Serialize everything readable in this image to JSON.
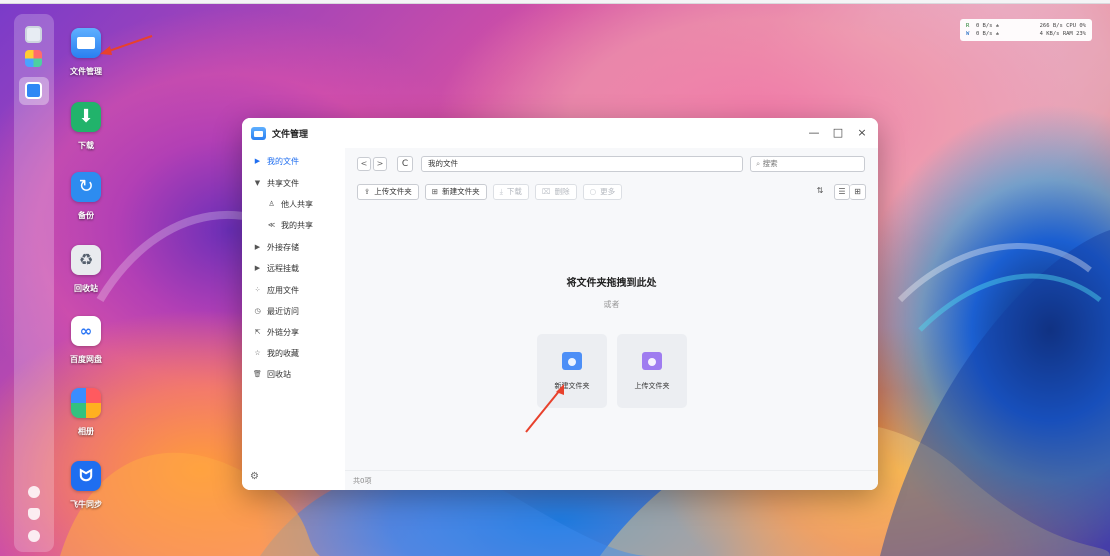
{
  "desktop": {
    "icons": [
      {
        "label": "文件管理"
      },
      {
        "label": "下载"
      },
      {
        "label": "备份"
      },
      {
        "label": "回收站"
      },
      {
        "label": "百度网盘"
      },
      {
        "label": "相册"
      },
      {
        "label": "飞牛同步"
      }
    ],
    "baidu_glyph": "∞",
    "sync_glyph": "ᗢ"
  },
  "system_monitor": {
    "rx_label": "R",
    "tx_label": "W",
    "rx_rate": "0 B/s",
    "tx_rate": "0 B/s",
    "rx_up": "266 B/s",
    "tx_up": "4 KB/s",
    "cpu_label": "CPU",
    "cpu_value": "0%",
    "ram_label": "RAM",
    "ram_value": "23%"
  },
  "window": {
    "title": "文件管理",
    "controls": {
      "minimize": "—",
      "maximize": "□",
      "close": "×"
    }
  },
  "sidebar": {
    "items": [
      {
        "label": "我的文件"
      },
      {
        "label": "共享文件"
      },
      {
        "label": "他人共享"
      },
      {
        "label": "我的共享"
      },
      {
        "label": "外接存储"
      },
      {
        "label": "远程挂载"
      },
      {
        "label": "应用文件"
      },
      {
        "label": "最近访问"
      },
      {
        "label": "外链分享"
      },
      {
        "label": "我的收藏"
      },
      {
        "label": "回收站"
      }
    ]
  },
  "toolbar": {
    "back": "<",
    "forward": ">",
    "refresh": "C",
    "path": "我的文件",
    "search_placeholder": "搜索",
    "upload_folder": "上传文件夹",
    "new_folder": "新建文件夹",
    "download": "下载",
    "delete": "删除",
    "more": "更多"
  },
  "main": {
    "drop_title": "将文件夹拖拽到此处",
    "drop_or": "或者",
    "card_new_folder": "新建文件夹",
    "card_upload_folder": "上传文件夹"
  },
  "status": {
    "count": "共0项"
  },
  "colors": {
    "accent": "#1f6ef0",
    "annotation_arrow": "#e8412c"
  }
}
